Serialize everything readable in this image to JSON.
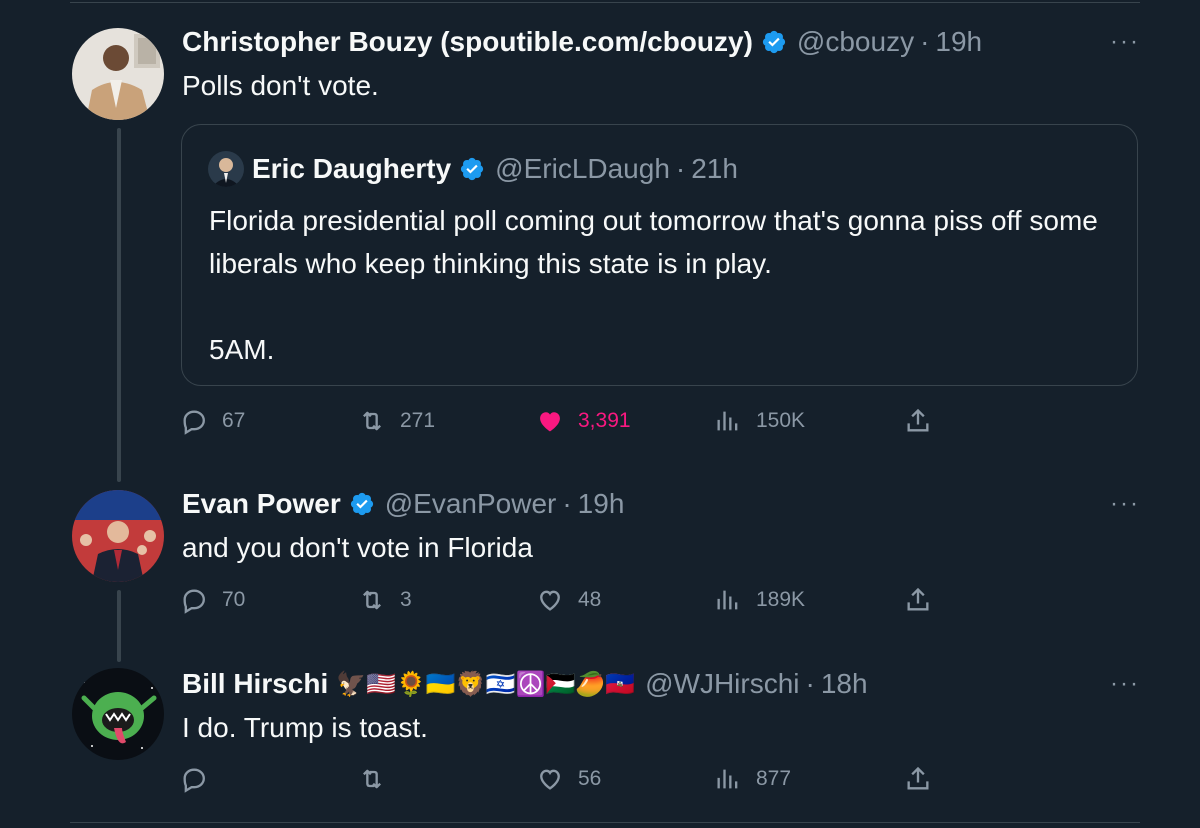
{
  "tweets": [
    {
      "name": "Christopher Bouzy (spoutible.com/cbouzy)",
      "handle": "@cbouzy",
      "dot": "·",
      "time": "19h",
      "text": "Polls don't vote.",
      "more": "···",
      "quote": {
        "name": "Eric Daugherty",
        "handle": "@EricLDaugh",
        "dot": "·",
        "time": "21h",
        "text_line1": "Florida presidential poll coming out tomorrow that's gonna piss off some liberals who keep thinking this state is in play.",
        "text_line2": "5AM."
      },
      "actions": {
        "replies": "67",
        "retweets": "271",
        "likes": "3,391",
        "views": "150K"
      }
    },
    {
      "name": "Evan Power",
      "handle": "@EvanPower",
      "dot": "·",
      "time": "19h",
      "text": "and you don't vote in Florida",
      "more": "···",
      "actions": {
        "replies": "70",
        "retweets": "3",
        "likes": "48",
        "views": "189K"
      }
    },
    {
      "name": "Bill Hirschi",
      "name_emojis": "🦅🇺🇸🌻🇺🇦🦁🇮🇱☮️🇵🇸🥭🇭🇹",
      "handle": "@WJHirschi",
      "dot": "·",
      "time": "18h",
      "text": "I do. Trump is toast.",
      "more": "···",
      "actions": {
        "replies": "",
        "retweets": "",
        "likes": "56",
        "views": "877"
      }
    }
  ],
  "colors": {
    "background": "#15202b",
    "text": "#f7f9f9",
    "secondary": "#8b98a5",
    "border": "#38444d",
    "verified": "#1d9bf0",
    "like": "#f91880"
  },
  "icons": [
    "verified-badge-icon",
    "reply-icon",
    "retweet-icon",
    "like-icon",
    "views-icon",
    "share-icon",
    "more-icon"
  ]
}
